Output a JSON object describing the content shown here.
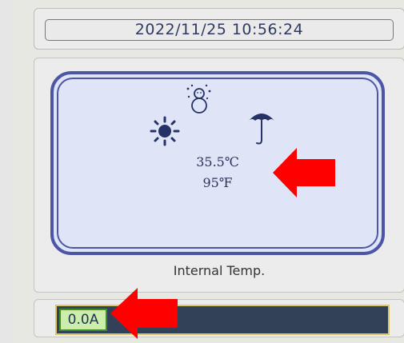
{
  "datetime": "2022/11/25 10:56:24",
  "temperature": {
    "celsius": "35.5℃",
    "fahrenheit": "95℉",
    "label": "Internal Temp.",
    "icons": [
      "sun-icon",
      "snowman-icon",
      "umbrella-icon"
    ]
  },
  "current": {
    "value": "0.0A",
    "level": 0
  },
  "annotations": {
    "arrows": [
      "red-arrow-icon",
      "red-arrow-icon"
    ],
    "color": "#ff0000"
  },
  "colors": {
    "frame": "#4c56a5",
    "screen": "#dfe5f6",
    "bar": "#324058",
    "value_bg": "#cdeeaa"
  }
}
